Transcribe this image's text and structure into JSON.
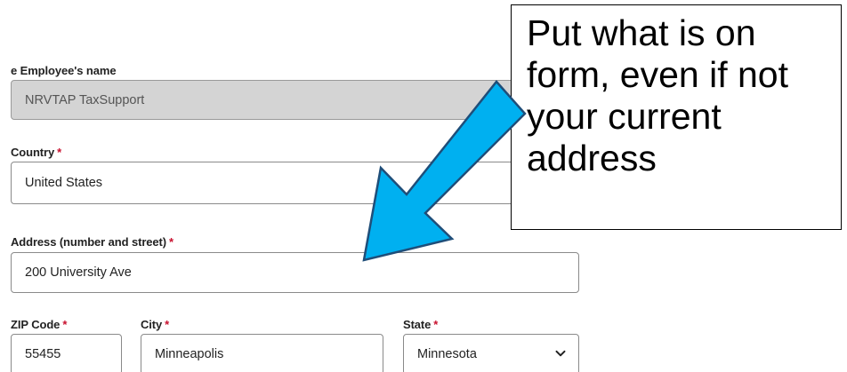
{
  "form": {
    "employee_name_label": "e Employee's name",
    "employee_name_value": "NRVTAP TaxSupport",
    "country_label": "Country",
    "country_value": "United States",
    "address_label": "Address (number and street)",
    "address_value": "200 University Ave",
    "zip_label": "ZIP Code",
    "zip_value": "55455",
    "city_label": "City",
    "city_value": "Minneapolis",
    "state_label": "State",
    "state_value": "Minnesota",
    "required_marker": "*"
  },
  "callout": {
    "lines": [
      "Put what is on",
      "form, even if not",
      "your current",
      "address"
    ]
  },
  "colors": {
    "arrow_fill": "#00b0f0",
    "required": "#c8102e",
    "disabled_field": "#d4d4d4"
  },
  "icons": {
    "state_dropdown": "chevron-down-icon"
  }
}
